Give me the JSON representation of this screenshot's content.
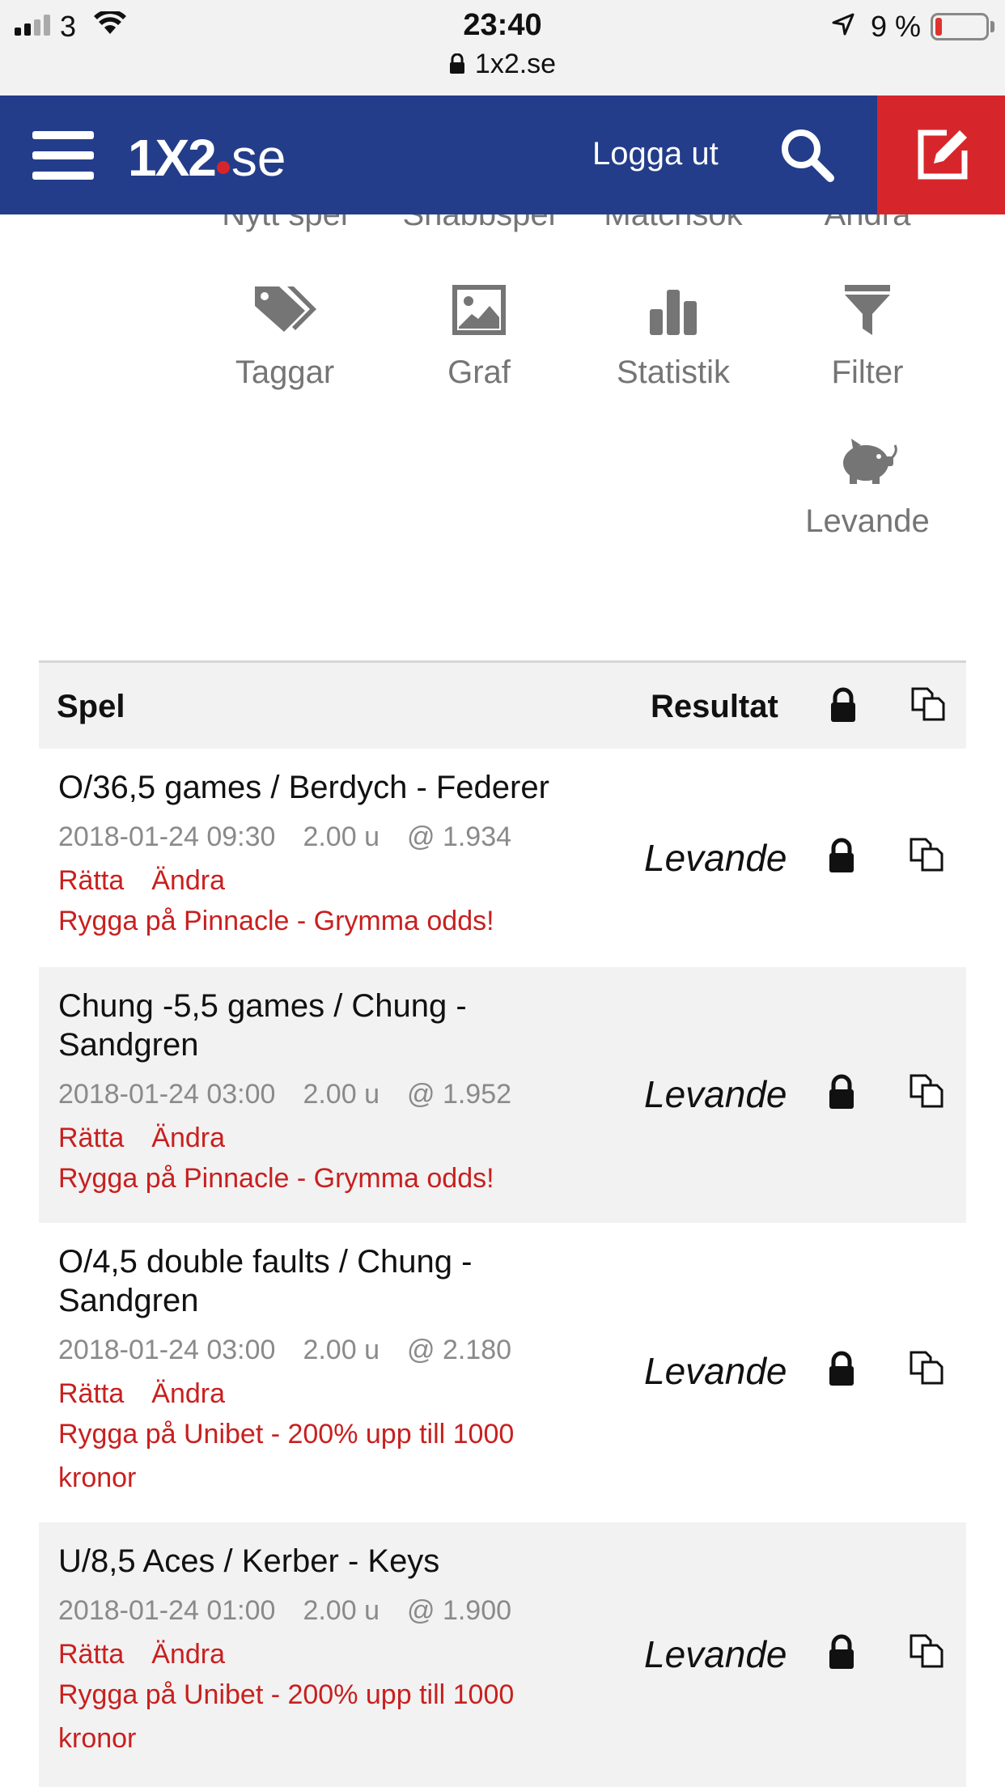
{
  "status_bar": {
    "carrier": "3",
    "time": "23:40",
    "url": "1x2.se",
    "battery": "9 %"
  },
  "header": {
    "logo_main": "1X2",
    "logo_suffix": "se",
    "logout_label": "Logga ut"
  },
  "menu": {
    "cut_row": [
      "Nytt spel",
      "Snabbspel",
      "Matchsök",
      "Ändra"
    ],
    "items": [
      {
        "label": "Taggar",
        "icon": "tag-icon"
      },
      {
        "label": "Graf",
        "icon": "image-icon"
      },
      {
        "label": "Statistik",
        "icon": "bar-chart-icon"
      },
      {
        "label": "Filter",
        "icon": "filter-icon"
      },
      {
        "label": "Levande",
        "icon": "piggy-bank-icon"
      }
    ]
  },
  "table": {
    "col_bet": "Spel",
    "col_result": "Resultat",
    "rows": [
      {
        "title": "O/36,5 games / Berdych - Federer",
        "date": "2018-01-24 09:30",
        "stake": "2.00 u",
        "odds": "@ 1.934",
        "correct": "Rätta",
        "edit": "Ändra",
        "ad": "Rygga på Pinnacle - Grymma odds!",
        "result": "Levande"
      },
      {
        "title": "Chung -5,5 games / Chung - Sandgren",
        "date": "2018-01-24 03:00",
        "stake": "2.00 u",
        "odds": "@ 1.952",
        "correct": "Rätta",
        "edit": "Ändra",
        "ad": "Rygga på Pinnacle - Grymma odds!",
        "result": "Levande"
      },
      {
        "title": "O/4,5 double faults / Chung - Sandgren",
        "date": "2018-01-24 03:00",
        "stake": "2.00 u",
        "odds": "@ 2.180",
        "correct": "Rätta",
        "edit": "Ändra",
        "ad": "Rygga på Unibet - 200% upp till 1000 kronor",
        "result": "Levande"
      },
      {
        "title": "U/8,5 Aces / Kerber - Keys",
        "date": "2018-01-24 01:00",
        "stake": "2.00 u",
        "odds": "@ 1.900",
        "correct": "Rätta",
        "edit": "Ändra",
        "ad": "Rygga på Unibet - 200% upp till 1000 kronor",
        "result": "Levande"
      }
    ]
  },
  "colors": {
    "header_bg": "#233d8a",
    "accent_red": "#d7262b",
    "link_red": "#c8201f",
    "muted_grey": "#757575"
  }
}
